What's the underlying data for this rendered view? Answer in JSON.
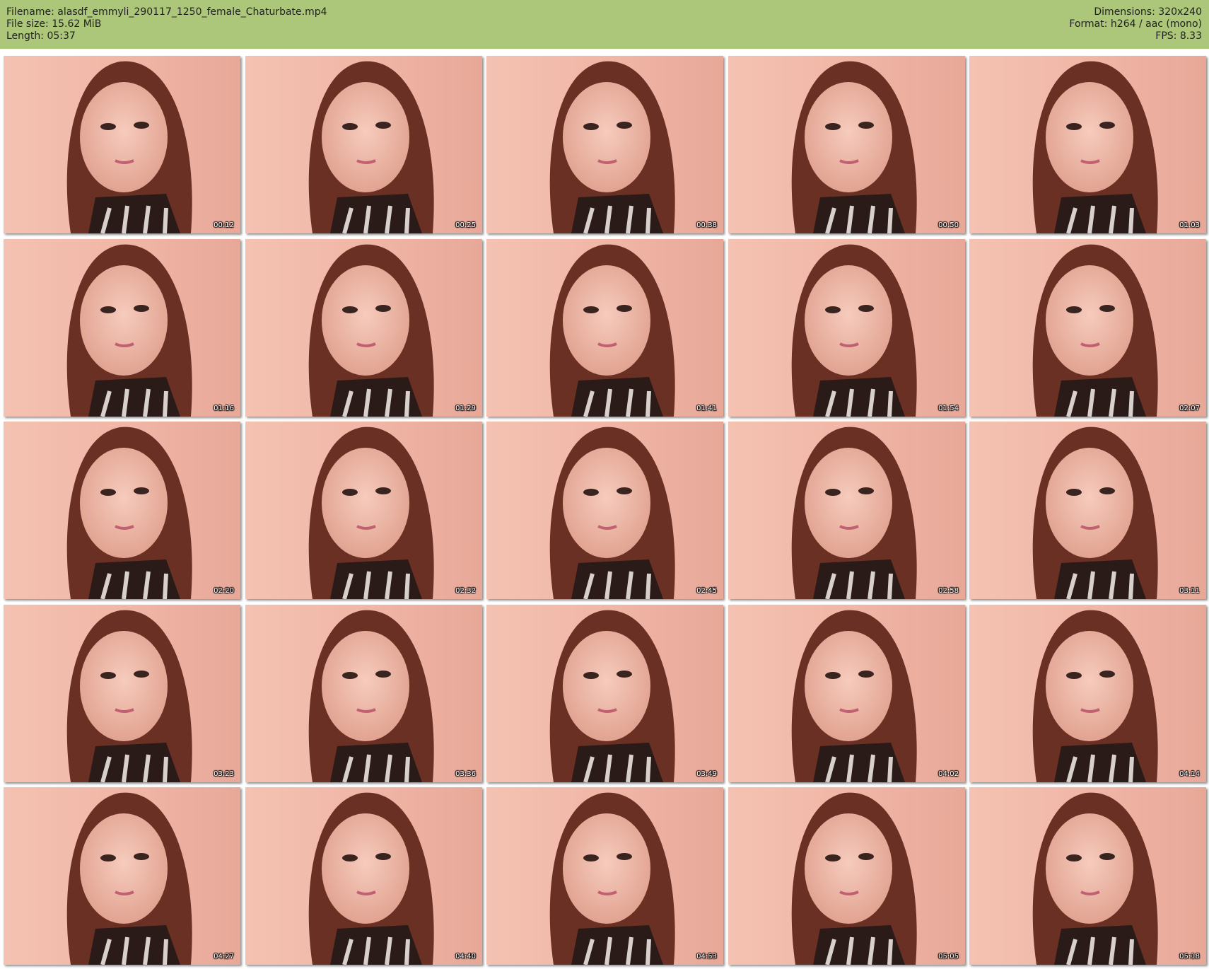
{
  "header": {
    "filename_line": "Filename: alasdf_emmyli_290117_1250_female_Chaturbate.mp4",
    "filesize_line": "File size: 15.62 MiB",
    "length_line": "Length: 05:37",
    "dimensions_line": "Dimensions: 320x240",
    "format_line": "Format: h264 / aac (mono)",
    "fps_line": "FPS: 8.33"
  },
  "colors": {
    "header_bg": "#acc67a",
    "page_bg": "#ffffff"
  },
  "thumbnails": [
    {
      "time": "00:12"
    },
    {
      "time": "00:25"
    },
    {
      "time": "00:38"
    },
    {
      "time": "00:50"
    },
    {
      "time": "01:03"
    },
    {
      "time": "01:16"
    },
    {
      "time": "01:29"
    },
    {
      "time": "01:41"
    },
    {
      "time": "01:54"
    },
    {
      "time": "02:07"
    },
    {
      "time": "02:20"
    },
    {
      "time": "02:32"
    },
    {
      "time": "02:45"
    },
    {
      "time": "02:58"
    },
    {
      "time": "03:11"
    },
    {
      "time": "03:23"
    },
    {
      "time": "03:36"
    },
    {
      "time": "03:49"
    },
    {
      "time": "04:02"
    },
    {
      "time": "04:14"
    },
    {
      "time": "04:27"
    },
    {
      "time": "04:40"
    },
    {
      "time": "04:53"
    },
    {
      "time": "05:05"
    },
    {
      "time": "05:18"
    }
  ]
}
